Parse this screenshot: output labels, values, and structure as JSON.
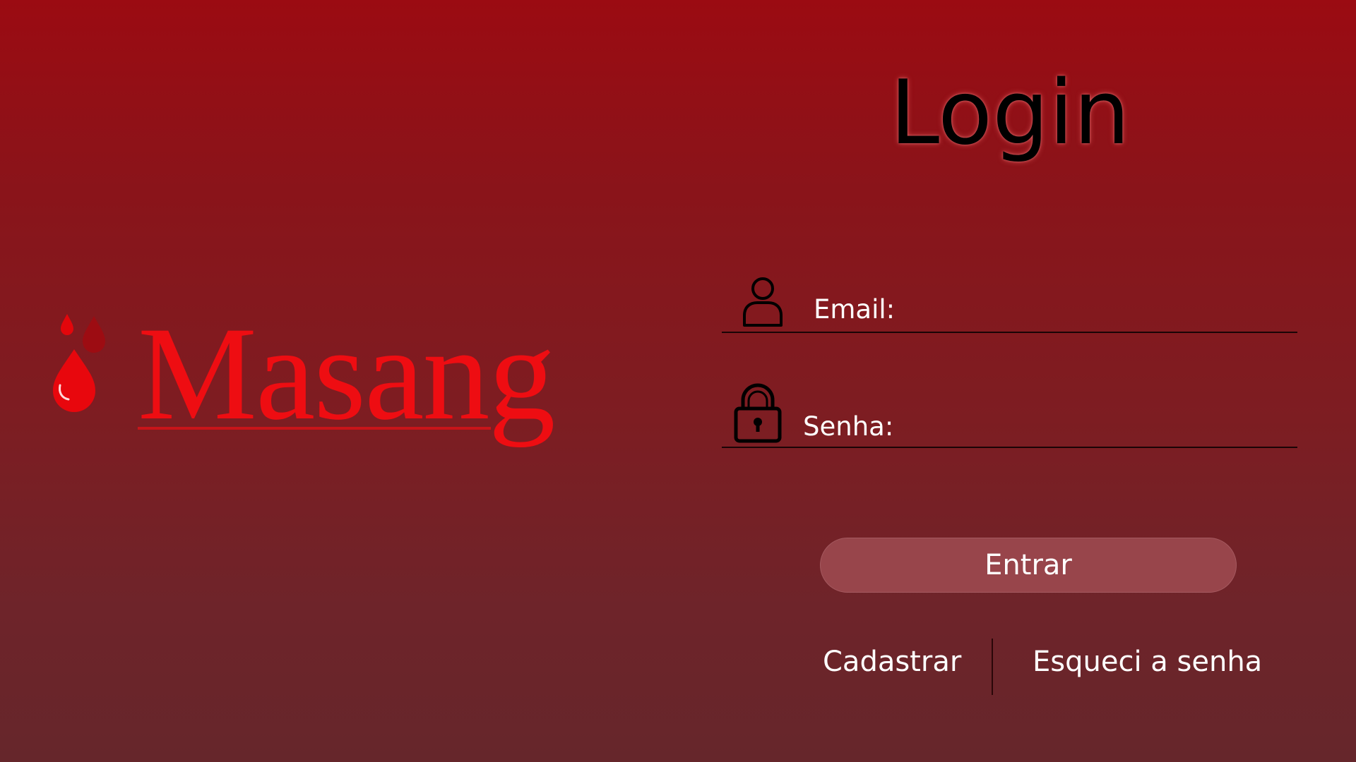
{
  "brand": {
    "name": "Masang",
    "logo_icon": "blood-drops-icon"
  },
  "login": {
    "title": "Login",
    "email_label": "Email:",
    "email_icon": "user-icon",
    "email_value": "",
    "password_label": "Senha:",
    "password_icon": "lock-icon",
    "password_value": "",
    "submit_label": "Entrar"
  },
  "links": {
    "register": "Cadastrar",
    "forgot_password": "Esqueci a senha"
  },
  "colors": {
    "background_top": "#9b0b12",
    "background_bottom": "#66262b",
    "brand_red": "#ee0d12",
    "button_fill": "#98454b",
    "title_text": "#000000"
  }
}
